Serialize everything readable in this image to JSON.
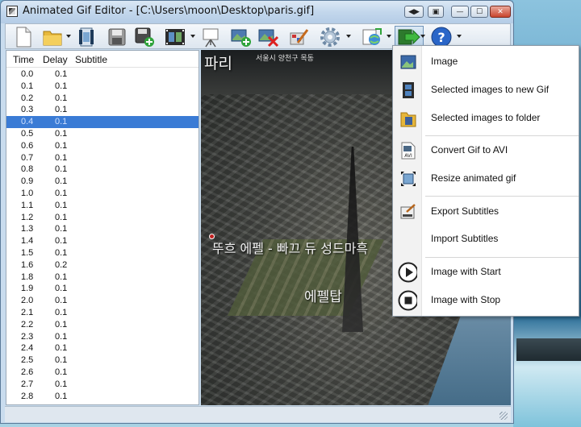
{
  "window": {
    "title": "Animated Gif Editor - [C:\\Users\\moon\\Desktop\\paris.gif]",
    "controls": [
      "◀▶",
      "▣",
      "—",
      "☐",
      "✕"
    ]
  },
  "toolbar": {
    "items": [
      "new-file",
      "open-folder",
      "open-video",
      "save",
      "save-as",
      "film",
      "slideshow",
      "add-image",
      "delete-image",
      "edit",
      "settings",
      "export-web",
      "export",
      "help"
    ]
  },
  "list": {
    "headers": {
      "time": "Time",
      "delay": "Delay",
      "subtitle": "Subtitle"
    },
    "selected_index": 4,
    "rows": [
      {
        "time": "0.0",
        "delay": "0.1"
      },
      {
        "time": "0.1",
        "delay": "0.1"
      },
      {
        "time": "0.2",
        "delay": "0.1"
      },
      {
        "time": "0.3",
        "delay": "0.1"
      },
      {
        "time": "0.4",
        "delay": "0.1"
      },
      {
        "time": "0.5",
        "delay": "0.1"
      },
      {
        "time": "0.6",
        "delay": "0.1"
      },
      {
        "time": "0.7",
        "delay": "0.1"
      },
      {
        "time": "0.8",
        "delay": "0.1"
      },
      {
        "time": "0.9",
        "delay": "0.1"
      },
      {
        "time": "1.0",
        "delay": "0.1"
      },
      {
        "time": "1.1",
        "delay": "0.1"
      },
      {
        "time": "1.2",
        "delay": "0.1"
      },
      {
        "time": "1.3",
        "delay": "0.1"
      },
      {
        "time": "1.4",
        "delay": "0.1"
      },
      {
        "time": "1.5",
        "delay": "0.1"
      },
      {
        "time": "1.6",
        "delay": "0.2"
      },
      {
        "time": "1.8",
        "delay": "0.1"
      },
      {
        "time": "1.9",
        "delay": "0.1"
      },
      {
        "time": "2.0",
        "delay": "0.1"
      },
      {
        "time": "2.1",
        "delay": "0.1"
      },
      {
        "time": "2.2",
        "delay": "0.1"
      },
      {
        "time": "2.3",
        "delay": "0.1"
      },
      {
        "time": "2.4",
        "delay": "0.1"
      },
      {
        "time": "2.5",
        "delay": "0.1"
      },
      {
        "time": "2.6",
        "delay": "0.1"
      },
      {
        "time": "2.7",
        "delay": "0.1"
      },
      {
        "time": "2.8",
        "delay": "0.1"
      }
    ]
  },
  "image": {
    "title": "파리",
    "small_text": "서울시 양천구 목동",
    "caption": "뚜흐 에펠 - 빠끄 듀 성드마흑",
    "landmark": "에펠탑"
  },
  "menu": {
    "items": [
      {
        "label": "Image",
        "icon": "image-icon"
      },
      {
        "label": "Selected images to new Gif",
        "icon": "film-gif-icon"
      },
      {
        "label": "Selected images to folder",
        "icon": "folder-icon"
      },
      {
        "label": "Convert Gif to AVI",
        "icon": "avi-file-icon"
      },
      {
        "label": "Resize animated gif",
        "icon": "resize-icon"
      },
      {
        "label": "Export Subtitles",
        "icon": "export-subtitles-icon"
      },
      {
        "label": "Import Subtitles",
        "icon": ""
      },
      {
        "label": "Image with Start",
        "icon": "play-icon"
      },
      {
        "label": "Image with Stop",
        "icon": "stop-icon"
      }
    ]
  }
}
